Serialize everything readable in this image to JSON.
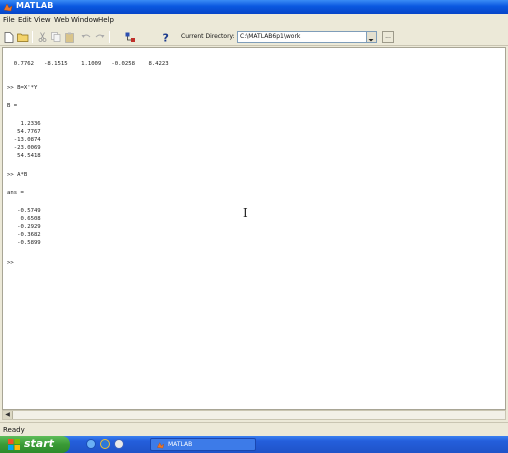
{
  "window": {
    "title": "MATLAB",
    "menu": [
      "File",
      "Edit",
      "View",
      "Web",
      "Window",
      "Help"
    ],
    "toolbar": {
      "current_directory_label": "Current Directory:",
      "current_directory_value": "C:\\MATLAB6p1\\work",
      "browse_label": "..."
    }
  },
  "console": {
    "lines": [
      "  0.7762   -8.1515    1.1009   -0.0258    8.4223",
      ">> B=X'*Y",
      "B =",
      "    1.2336",
      "   54.7767",
      "  -13.0874",
      "  -23.0069",
      "   54.5418",
      ">> A*B",
      "ans =",
      "   -0.5749",
      "    0.6508",
      "   -0.2929",
      "   -0.3682",
      "   -0.5899",
      ">>"
    ]
  },
  "status": {
    "text": "Ready"
  },
  "taskbar": {
    "start_label": "start",
    "task_label": "MATLAB"
  },
  "colors": {
    "title_bar": "#0a58e0",
    "window_bg": "#ece9d8",
    "taskbar": "#245edb",
    "start_button": "#3a9a36"
  }
}
